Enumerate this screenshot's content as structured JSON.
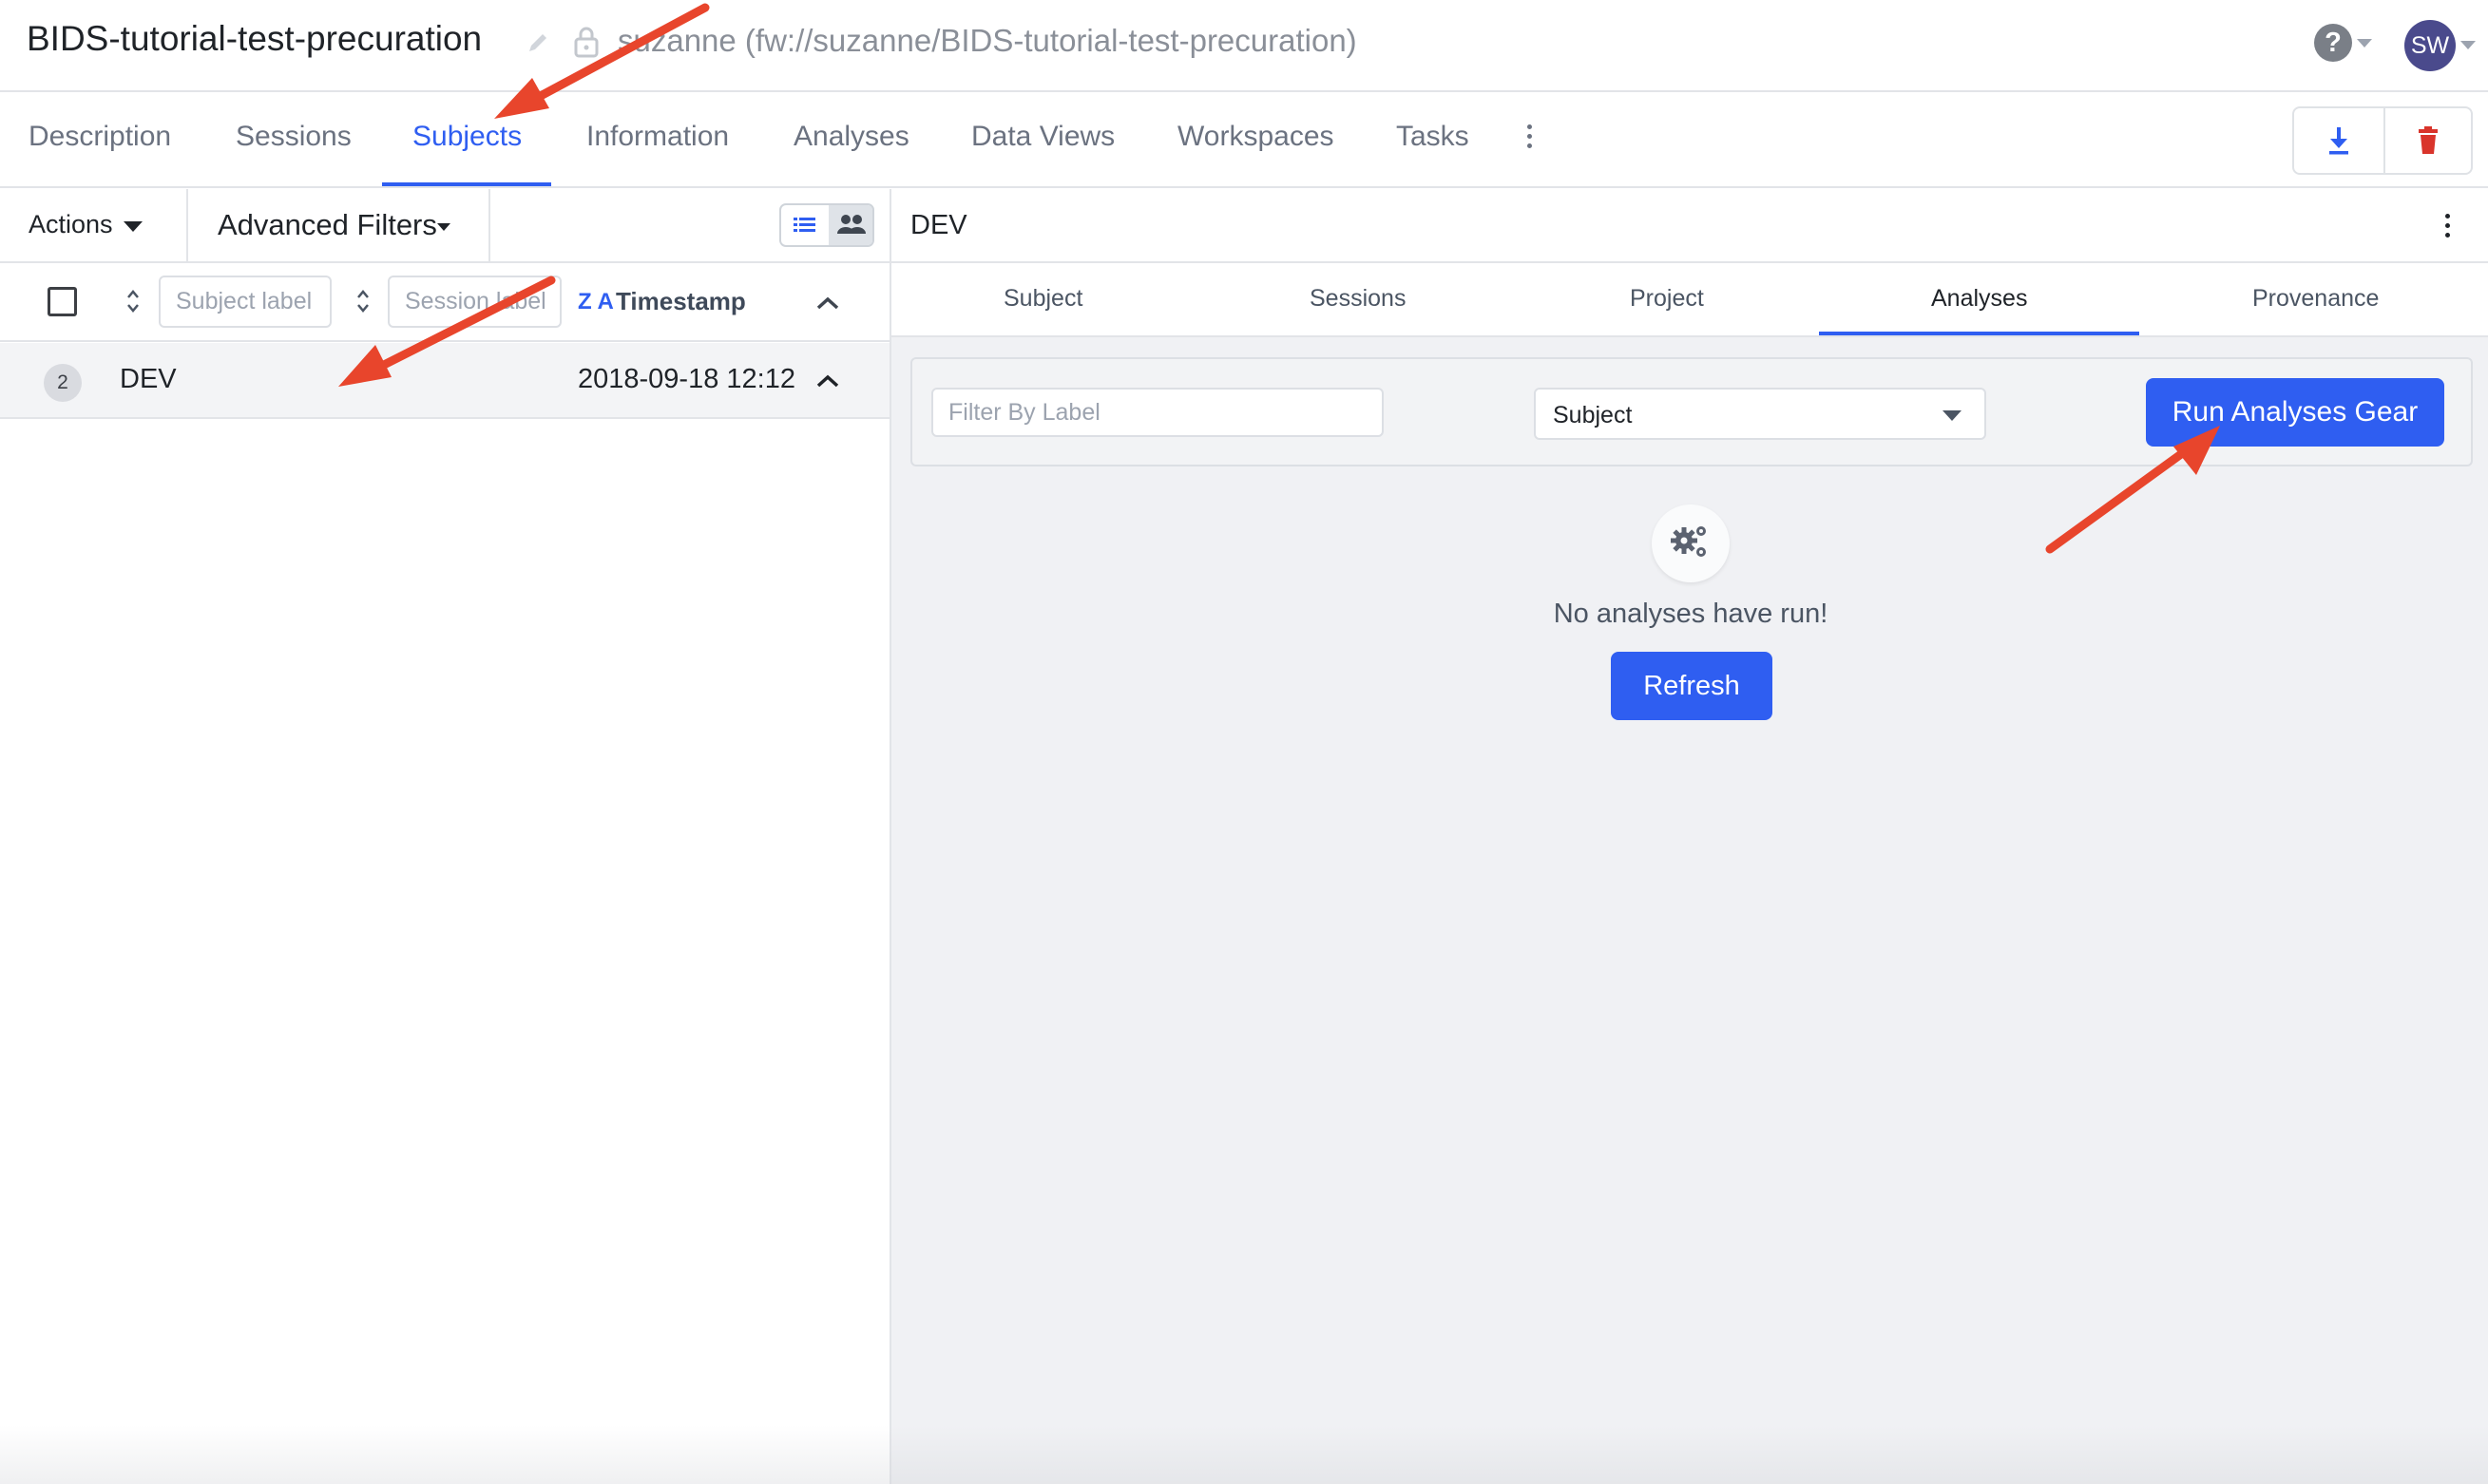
{
  "header": {
    "project_title": "BIDS-tutorial-test-precuration",
    "project_path": "suzanne (fw://suzanne/BIDS-tutorial-test-precuration)",
    "user_initials": "SW",
    "help_symbol": "?"
  },
  "tabs": [
    {
      "label": "Description"
    },
    {
      "label": "Sessions"
    },
    {
      "label": "Subjects",
      "active": true
    },
    {
      "label": "Information"
    },
    {
      "label": "Analyses"
    },
    {
      "label": "Data Views"
    },
    {
      "label": "Workspaces"
    },
    {
      "label": "Tasks"
    }
  ],
  "left_panel": {
    "actions_label": "Actions",
    "advanced_filters_label": "Advanced Filters",
    "subject_label_placeholder": "Subject label",
    "session_label_placeholder": "Session label",
    "sort_indicator": "Z A",
    "timestamp_header": "Timestamp",
    "rows": [
      {
        "count": "2",
        "label": "DEV",
        "timestamp": "2018-09-18 12:12"
      }
    ]
  },
  "right_panel": {
    "title": "DEV",
    "subtabs": [
      {
        "label": "Subject"
      },
      {
        "label": "Sessions"
      },
      {
        "label": "Project"
      },
      {
        "label": "Analyses",
        "active": true
      },
      {
        "label": "Provenance"
      }
    ],
    "filter_placeholder": "Filter By Label",
    "level_select_value": "Subject",
    "run_gear_label": "Run Analyses Gear",
    "empty_message": "No analyses have run!",
    "refresh_label": "Refresh"
  },
  "colors": {
    "accent": "#2f5ef1",
    "annotation_arrow": "#e8452c",
    "delete_red": "#d9342b"
  }
}
